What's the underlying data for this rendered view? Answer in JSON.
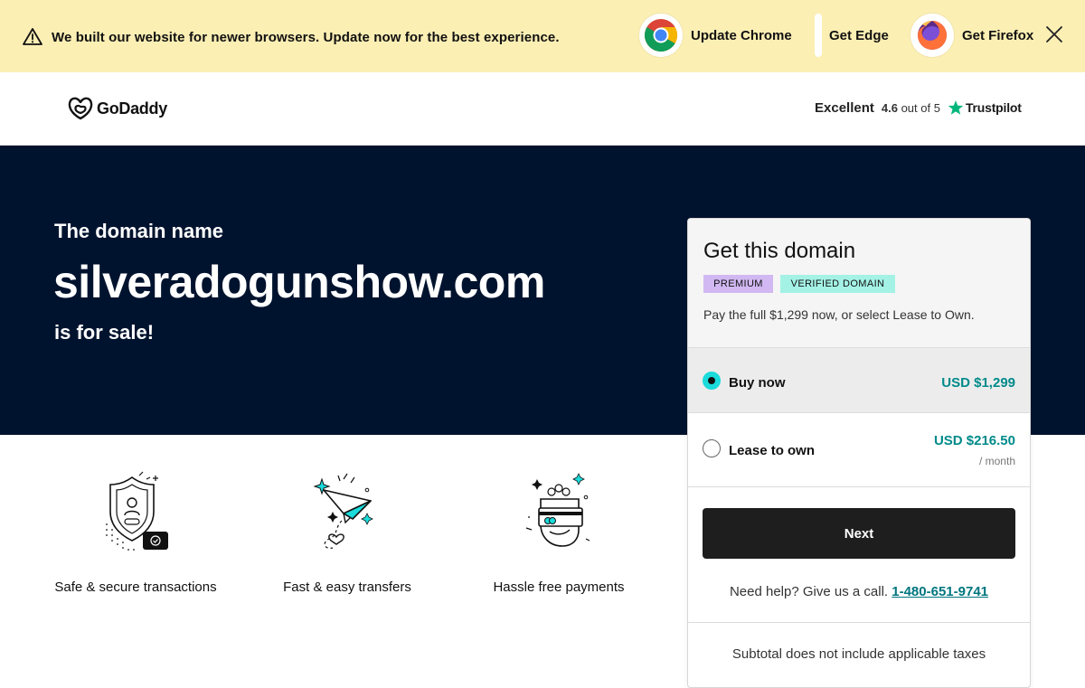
{
  "banner": {
    "message": "We built our website for newer browsers. Update now for the best experience.",
    "buttons": [
      {
        "label": "Update Chrome",
        "icon": "chrome-icon"
      },
      {
        "label": "Get Edge",
        "icon": "edge-icon"
      },
      {
        "label": "Get Firefox",
        "icon": "firefox-icon"
      }
    ],
    "background": "#fcefb4"
  },
  "header": {
    "logo_text": "GoDaddy",
    "trustpilot": {
      "label": "Excellent",
      "score": "4.6",
      "score_suffix": "out of 5",
      "brand": "Trustpilot",
      "star_color": "#00b67a"
    }
  },
  "hero": {
    "pre_text": "The domain name",
    "domain": "silveradogunshow.com",
    "post_text": "is for sale!",
    "background": "#00132e"
  },
  "features": [
    {
      "label": "Safe & secure transactions",
      "icon": "shield-icon"
    },
    {
      "label": "Fast & easy transfers",
      "icon": "paper-plane-icon"
    },
    {
      "label": "Hassle free payments",
      "icon": "payment-card-icon"
    }
  ],
  "card": {
    "title": "Get this domain",
    "badges": {
      "premium": "PREMIUM",
      "verified": "VERIFIED DOMAIN"
    },
    "description": "Pay the full $1,299 now, or select Lease to Own.",
    "options": {
      "buy": {
        "label": "Buy now",
        "price": "USD $1,299",
        "selected": true
      },
      "lease": {
        "label": "Lease to own",
        "price": "USD $216.50",
        "period": "/ month",
        "selected": false
      }
    },
    "next_label": "Next",
    "help_text": "Need help? Give us a call.",
    "phone": "1-480-651-9741",
    "subtotal_note": "Subtotal does not include applicable taxes",
    "accent_color": "#1bdbdb",
    "price_color": "#008a8a"
  }
}
